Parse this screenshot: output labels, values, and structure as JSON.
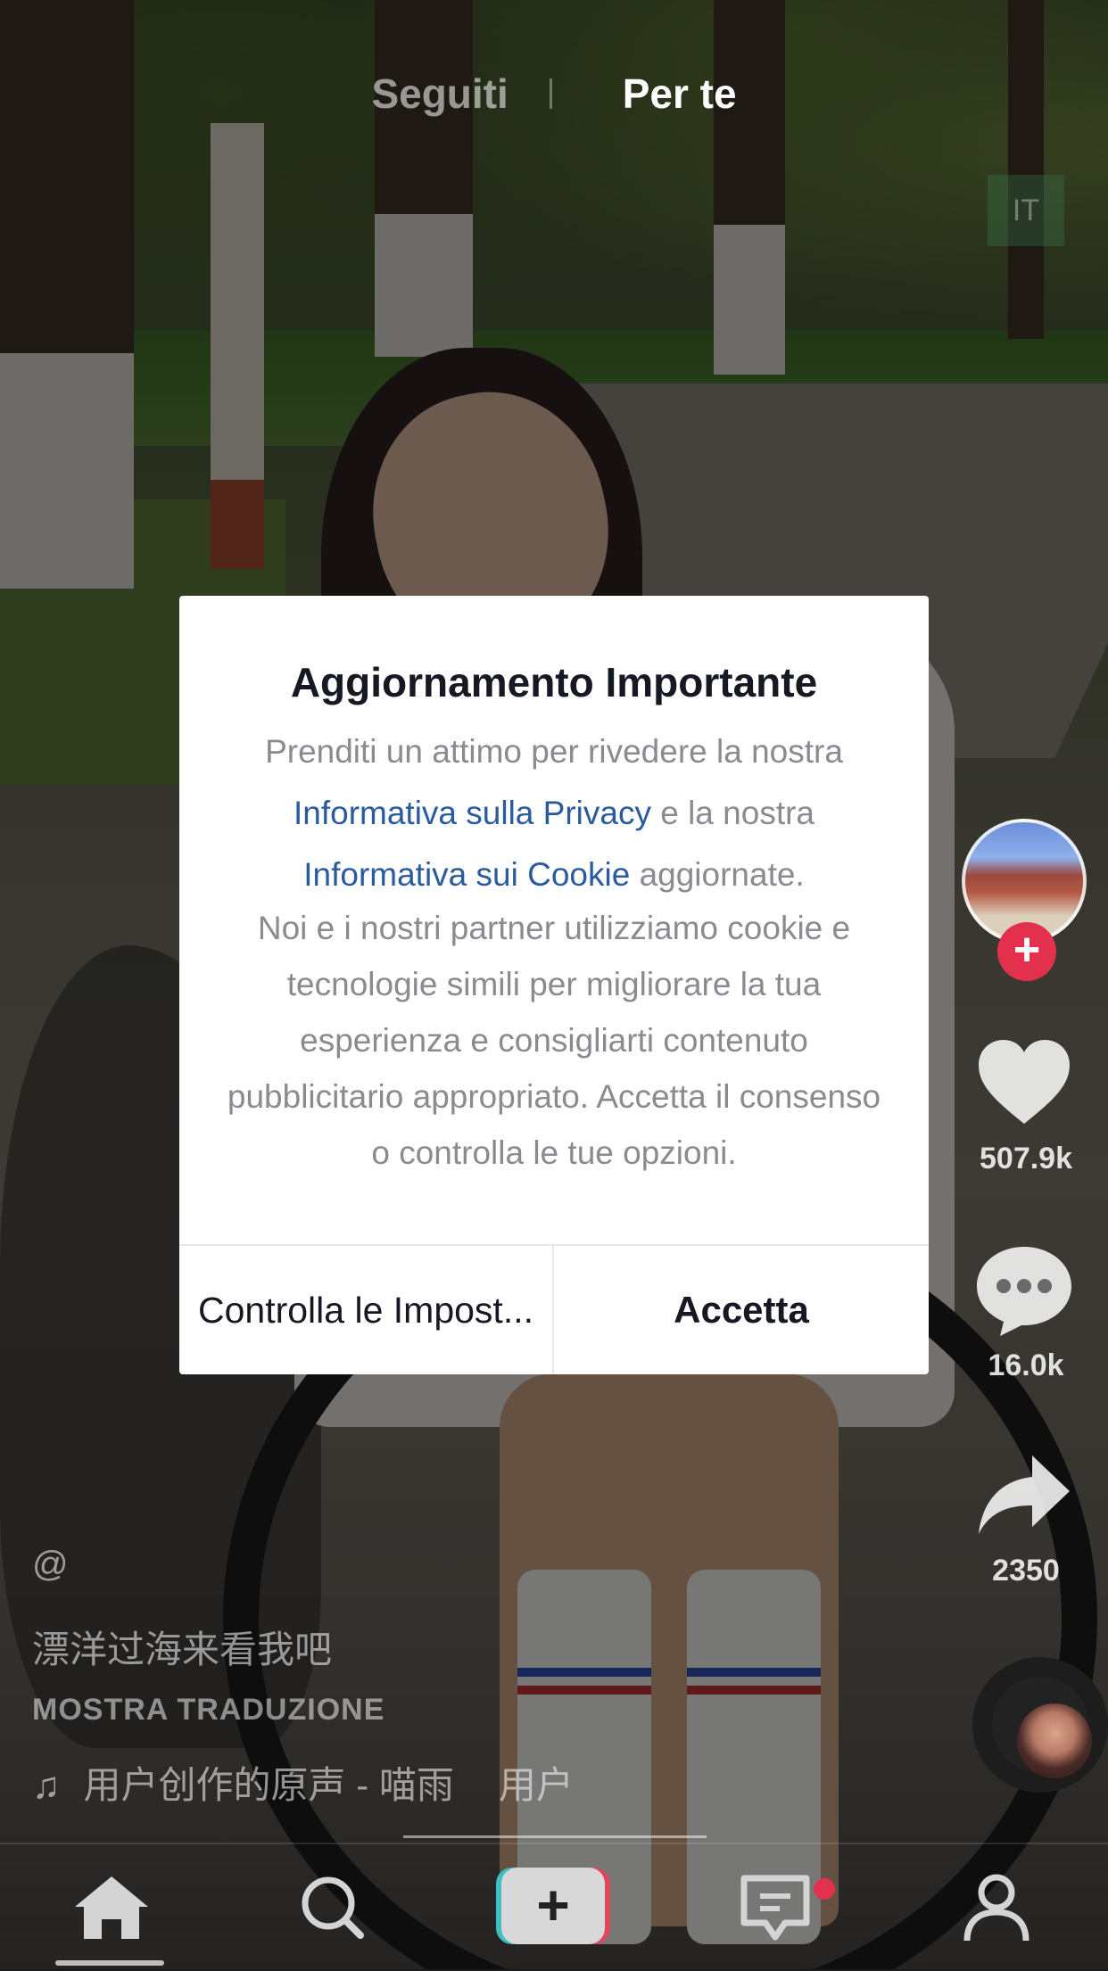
{
  "top_tabs": {
    "following": "Seguiti",
    "for_you": "Per te"
  },
  "lang_badge": "IT",
  "rail": {
    "likes": "507.9k",
    "comments": "16.0k",
    "shares": "2350",
    "follow_plus": "+"
  },
  "caption": {
    "handle": "@",
    "description": "漂洋过海来看我吧",
    "translate": "MOSTRA TRADUZIONE",
    "music_note": "♫",
    "sound": "用户创作的原声 - 喵雨",
    "sound_cont": "用户"
  },
  "bottom_nav": {
    "create_symbol": "+",
    "icons": [
      "home-icon",
      "search-icon",
      "create-icon",
      "inbox-icon",
      "profile-icon"
    ]
  },
  "modal": {
    "title": "Aggiornamento Importante",
    "body_intro": "Prenditi un attimo per rivedere la nostra",
    "privacy_link": "Informativa sulla Privacy",
    "body_mid": "e la nostra",
    "cookie_link": "Informativa sui Cookie",
    "body_end": "aggiornate.",
    "body_p2": "Noi e i nostri partner utilizziamo cookie e tecnologie simili per migliorare la tua esperienza e consigliarti contenuto pubblicitario appropriato. Accetta il consenso o controlla le tue opzioni.",
    "settings_button": "Controlla le Impost...",
    "accept_button": "Accetta"
  },
  "colors": {
    "accent_red": "#e3304d",
    "link_blue": "#2a5b9c",
    "create_cyan": "#3fbfc4",
    "create_red": "#e0475a"
  }
}
